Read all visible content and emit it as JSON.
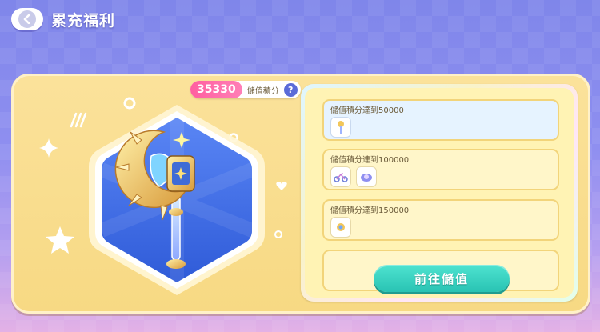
{
  "header": {
    "title": "累充福利"
  },
  "points": {
    "value": "35330",
    "label": "儲值積分",
    "help": "?"
  },
  "tiers": [
    {
      "label": "儲值積分達到50000",
      "rewards": [
        "staff-item-icon"
      ],
      "selected": true
    },
    {
      "label": "儲值積分達到100000",
      "rewards": [
        "bike-item-icon",
        "hat-item-icon"
      ],
      "selected": false
    },
    {
      "label": "儲值積分達到150000",
      "rewards": [
        "orb-item-icon"
      ],
      "selected": false
    }
  ],
  "actions": {
    "go_label": "前往儲值"
  },
  "colors": {
    "accent": "#29c3b3",
    "points": "#ff5fa0",
    "card": "#fbe29b"
  }
}
